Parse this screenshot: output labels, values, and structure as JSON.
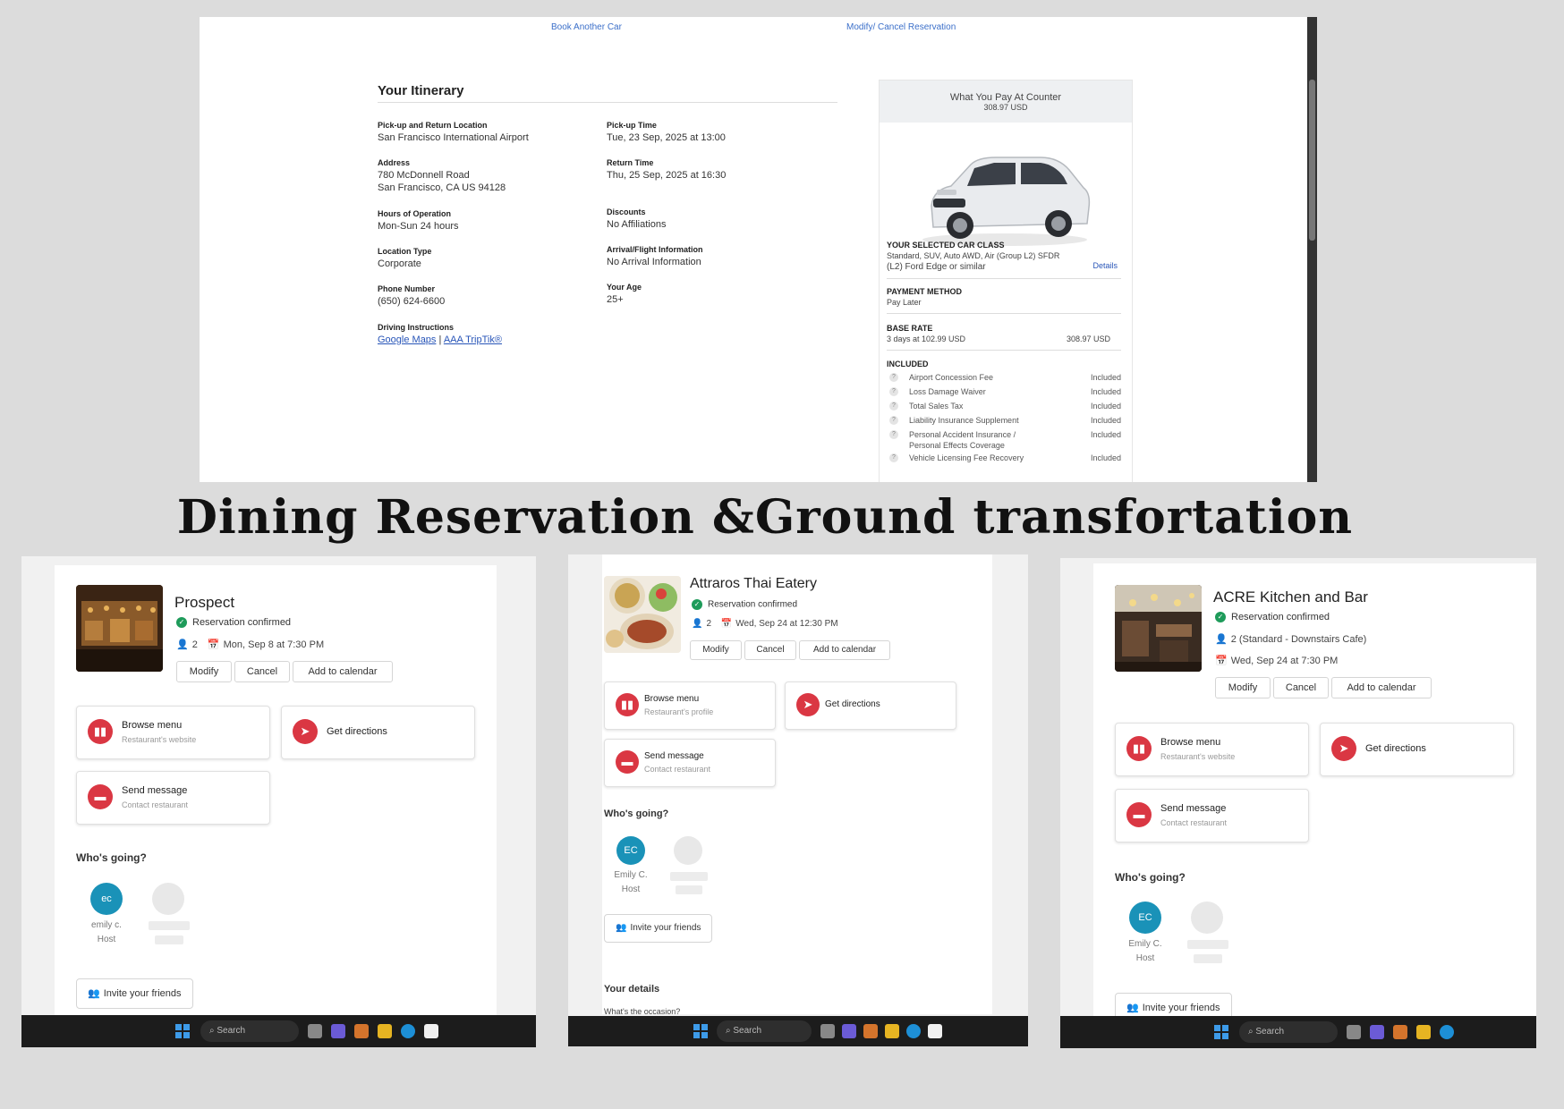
{
  "rental": {
    "top_links": {
      "book_another": "Book Another Car",
      "modify_cancel": "Modify/ Cancel Reservation"
    },
    "itinerary_title": "Your Itinerary",
    "pickup_location": {
      "label": "Pick-up and Return Location",
      "value": "San Francisco International Airport"
    },
    "address": {
      "label": "Address",
      "line1": "780 McDonnell Road",
      "line2": "San Francisco, CA US 94128"
    },
    "hours": {
      "label": "Hours of Operation",
      "value": "Mon-Sun 24 hours"
    },
    "location_type": {
      "label": "Location Type",
      "value": "Corporate"
    },
    "phone": {
      "label": "Phone Number",
      "value": "(650) 624-6600"
    },
    "driving": {
      "label": "Driving Instructions",
      "link1": "Google Maps",
      "sep": "|",
      "link2": "AAA TripTik®"
    },
    "pickup_time": {
      "label": "Pick-up Time",
      "value": "Tue, 23 Sep, 2025 at 13:00"
    },
    "return_time": {
      "label": "Return Time",
      "value": "Thu, 25 Sep, 2025 at 16:30"
    },
    "discounts": {
      "label": "Discounts",
      "value": "No Affiliations"
    },
    "arrival": {
      "label": "Arrival/Flight Information",
      "value": "No Arrival Information"
    },
    "age": {
      "label": "Your Age",
      "value": "25+"
    },
    "summary": {
      "header": "What You Pay At Counter",
      "header_amount": "308.97 USD",
      "car_class_label": "YOUR SELECTED CAR CLASS",
      "car_class_desc": "Standard, SUV, Auto AWD, Air (Group L2) SFDR",
      "car_model": "(L2) Ford Edge or similar",
      "details_link": "Details",
      "payment_label": "PAYMENT METHOD",
      "payment_value": "Pay Later",
      "base_label": "BASE RATE",
      "base_desc": "3 days at 102.99 USD",
      "base_total": "308.97 USD",
      "included_label": "INCLUDED",
      "included": [
        {
          "name": "Airport Concession Fee",
          "value": "Included"
        },
        {
          "name": "Loss Damage Waiver",
          "value": "Included"
        },
        {
          "name": "Total Sales Tax",
          "value": "Included"
        },
        {
          "name": "Liability Insurance Supplement",
          "value": "Included"
        },
        {
          "name": "Personal Accident Insurance / Personal Effects Coverage",
          "value": "Included"
        },
        {
          "name": "Vehicle Licensing Fee Recovery",
          "value": "Included"
        }
      ]
    }
  },
  "headline": "Dining Reservation &Ground transfortation",
  "reservations": [
    {
      "name": "Prospect",
      "status": "Reservation confirmed",
      "party": "2",
      "date": "Mon, Sep 8 at 7:30 PM",
      "buttons": {
        "modify": "Modify",
        "cancel": "Cancel",
        "calendar": "Add to calendar"
      },
      "browse": {
        "title": "Browse menu",
        "sub": "Restaurant's website"
      },
      "directions": "Get directions",
      "message": {
        "title": "Send message",
        "sub": "Contact restaurant"
      },
      "whos_going": "Who's going?",
      "guest": {
        "initials": "ec",
        "name": "emily c.",
        "role": "Host"
      },
      "invite": "Invite your friends"
    },
    {
      "name": "Attraros Thai Eatery",
      "status": "Reservation confirmed",
      "party": "2",
      "date": "Wed, Sep 24 at 12:30 PM",
      "buttons": {
        "modify": "Modify",
        "cancel": "Cancel",
        "calendar": "Add to calendar"
      },
      "browse": {
        "title": "Browse menu",
        "sub": "Restaurant's profile"
      },
      "directions": "Get directions",
      "message": {
        "title": "Send message",
        "sub": "Contact restaurant"
      },
      "whos_going": "Who's going?",
      "guest": {
        "initials": "EC",
        "name": "Emily C.",
        "role": "Host"
      },
      "invite": "Invite your friends",
      "your_details": "Your details",
      "occasion": "What's the occasion?"
    },
    {
      "name": "ACRE Kitchen and Bar",
      "status": "Reservation confirmed",
      "party": "2 (Standard - Downstairs Cafe)",
      "date": "Wed, Sep 24 at 7:30 PM",
      "buttons": {
        "modify": "Modify",
        "cancel": "Cancel",
        "calendar": "Add to calendar"
      },
      "browse": {
        "title": "Browse menu",
        "sub": "Restaurant's website"
      },
      "directions": "Get directions",
      "message": {
        "title": "Send message",
        "sub": "Contact restaurant"
      },
      "whos_going": "Who's going?",
      "guest": {
        "initials": "EC",
        "name": "Emily C.",
        "role": "Host"
      },
      "invite": "Invite your friends"
    }
  ],
  "taskbar": {
    "search_placeholder": "Search"
  },
  "colors": {
    "accent_red": "#da3743",
    "confirmed_green": "#1e9b5a",
    "avatar_blue": "#1a92b8",
    "link_blue": "#2855b8"
  }
}
